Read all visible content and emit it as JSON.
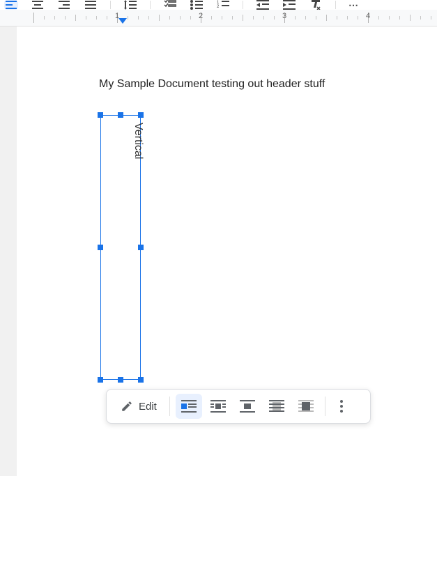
{
  "ruler": {
    "marks": [
      "1",
      "2",
      "3",
      "4"
    ]
  },
  "document": {
    "body_text": "My Sample Document testing out header stuff",
    "textbox_content": "Vertical"
  },
  "context_toolbar": {
    "edit_label": "Edit",
    "wrap_options": [
      {
        "name": "inline",
        "active": true
      },
      {
        "name": "wrap-text",
        "active": false
      },
      {
        "name": "break-text",
        "active": false
      },
      {
        "name": "behind-text",
        "active": false
      },
      {
        "name": "in-front-of-text",
        "active": false
      }
    ]
  },
  "icons": {
    "edit": "pencil",
    "more": "more-vert"
  }
}
